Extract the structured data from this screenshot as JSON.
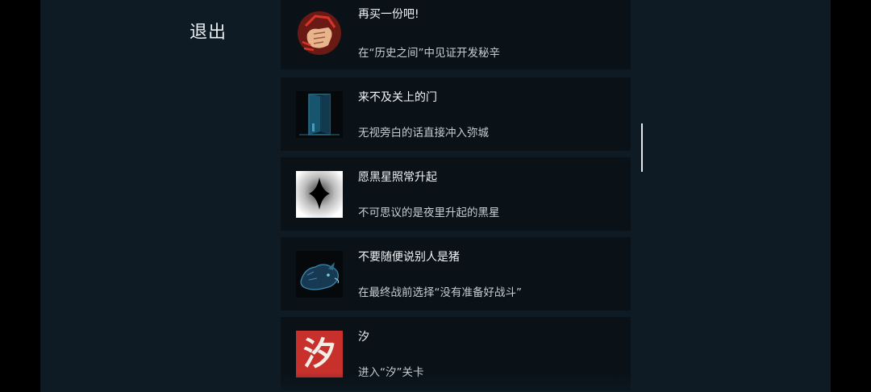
{
  "header": {
    "exit_label": "退出"
  },
  "achievements": [
    {
      "title": "再买一份吧!",
      "description": "在“历史之间”中见证开发秘辛",
      "icon": "fist-icon"
    },
    {
      "title": "来不及关上的门",
      "description": "无视旁白的话直接冲入弥城",
      "icon": "door-icon"
    },
    {
      "title": "愿黑星照常升起",
      "description": "不可思议的是夜里升起的黑星",
      "icon": "black-star-icon"
    },
    {
      "title": "不要随便说别人是猪",
      "description": "在最终战前选择“没有准备好战斗”",
      "icon": "boar-icon"
    },
    {
      "title": "汐",
      "description": "进入“汐”关卡",
      "icon": "xi-glyph-icon",
      "glyph": "汐"
    }
  ],
  "colors": {
    "background": "#0f1b24",
    "card": "#0a1218",
    "xi_red": "#c8302c"
  }
}
